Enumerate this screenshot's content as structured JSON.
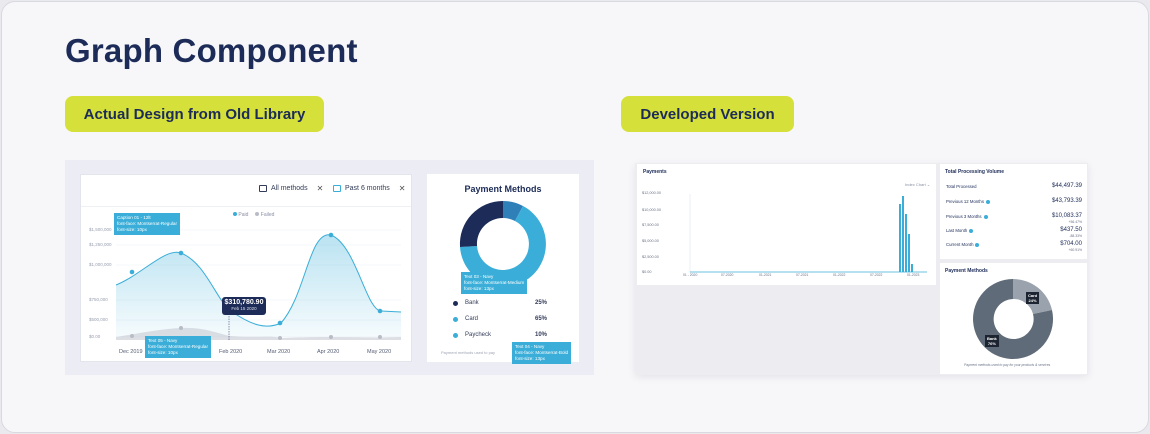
{
  "page": {
    "title": "Graph Component",
    "pill_old": "Actual Design from Old Library",
    "pill_dev": "Developed Version"
  },
  "colors": {
    "navy": "#1c2b57",
    "accent_pill": "#d6e03a",
    "blue": "#3aaed8",
    "slate": "#5f6b78"
  },
  "old": {
    "filter_methods": "All methods",
    "filter_period": "Past 6 months",
    "legend": [
      "Paid",
      "Failed"
    ],
    "y_ticks": [
      "$1,500,000",
      "$1,250,000",
      "$1,000,000",
      "$750,000",
      "$500,000",
      "$250,000",
      "$0.00"
    ],
    "x_ticks": [
      "Dec 2019",
      "Jan 2020",
      "Feb 2020",
      "Mar 2020",
      "Apr 2020",
      "May 2020"
    ],
    "tooltip_value": "$310,780.90",
    "tooltip_date": "Feb 15 2020",
    "caption_tag": [
      "Caption 01 - 12lt",
      "font-face: Montserrat-Regular",
      "font-size: 10px"
    ],
    "text_tag": [
      "Text 05 - Navy",
      "font-face: Montserrat-Regular",
      "font-size: 10px"
    ],
    "payment_title": "Payment Methods",
    "payment_tag": [
      "Text 03 - Navy",
      "font-face: Montserrat-Medium",
      "font-size: 13px"
    ],
    "payment_rows": [
      {
        "label": "Bank",
        "pct": "25%",
        "color": "#1c2b57"
      },
      {
        "label": "Card",
        "pct": "65%",
        "color": "#3aaed8"
      },
      {
        "label": "Paycheck",
        "pct": "10%",
        "color": "#3aaed8"
      }
    ],
    "payment_foot": "Payment methods used to pay",
    "bold_tag": [
      "Text 04 - Navy",
      "font-face: Montserrat-Bold",
      "font-size: 13px"
    ]
  },
  "dev": {
    "payments_title": "Payments",
    "dropdown": "Index Chart",
    "y_ticks": [
      "$12,000.00",
      "$10,000.00",
      "$7,500.00",
      "$5,000.00",
      "$2,500.00",
      "$0.00"
    ],
    "x_ticks": [
      "01 - 2020",
      "07-2020",
      "01-2021",
      "07-2021",
      "01-2022",
      "07-2022",
      "01-2023"
    ],
    "tpv_title": "Total Processing Volume",
    "tpv_rows": [
      {
        "label": "Total Processed",
        "value": "$44,497.39",
        "change": ""
      },
      {
        "label": "Previous 12 Months",
        "value": "$43,793.39",
        "change": ""
      },
      {
        "label": "Previous 3 Months",
        "value": "$10,083.37",
        "change": "+56.47%"
      },
      {
        "label": "Last Month",
        "value": "$437.50",
        "change": "-88.33%"
      },
      {
        "label": "Current Month",
        "value": "$704.00",
        "change": "+60.91%"
      }
    ],
    "pm_title": "Payment Methods",
    "pm_card": [
      "Card",
      "24%"
    ],
    "pm_bank": [
      "Bank",
      "76%"
    ],
    "pm_foot": "Payment methods used to pay for your products & services"
  }
}
